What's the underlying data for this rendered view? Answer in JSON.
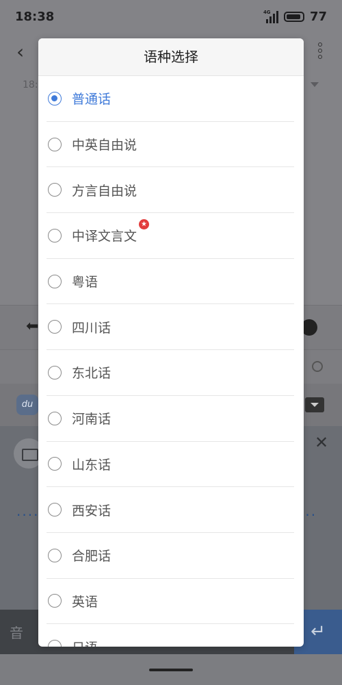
{
  "status_bar": {
    "time": "18:38",
    "network_type": "4G",
    "battery_level": "77"
  },
  "background": {
    "timestamp_partial": "18:",
    "keyboard_key_partial": "音"
  },
  "dialog": {
    "title": "语种选择",
    "options": [
      {
        "label": "普通话",
        "selected": true
      },
      {
        "label": "中英自由说",
        "selected": false
      },
      {
        "label": "方言自由说",
        "selected": false
      },
      {
        "label": "中译文言文",
        "selected": false,
        "badge": true
      },
      {
        "label": "粤语",
        "selected": false
      },
      {
        "label": "四川话",
        "selected": false
      },
      {
        "label": "东北话",
        "selected": false
      },
      {
        "label": "河南话",
        "selected": false
      },
      {
        "label": "山东话",
        "selected": false
      },
      {
        "label": "西安话",
        "selected": false
      },
      {
        "label": "合肥话",
        "selected": false
      },
      {
        "label": "英语",
        "selected": false
      },
      {
        "label": "日语",
        "selected": false
      }
    ]
  },
  "colors": {
    "accent": "#3f7ad9",
    "badge": "#e23b3b",
    "overlay": "#7f7f83"
  }
}
